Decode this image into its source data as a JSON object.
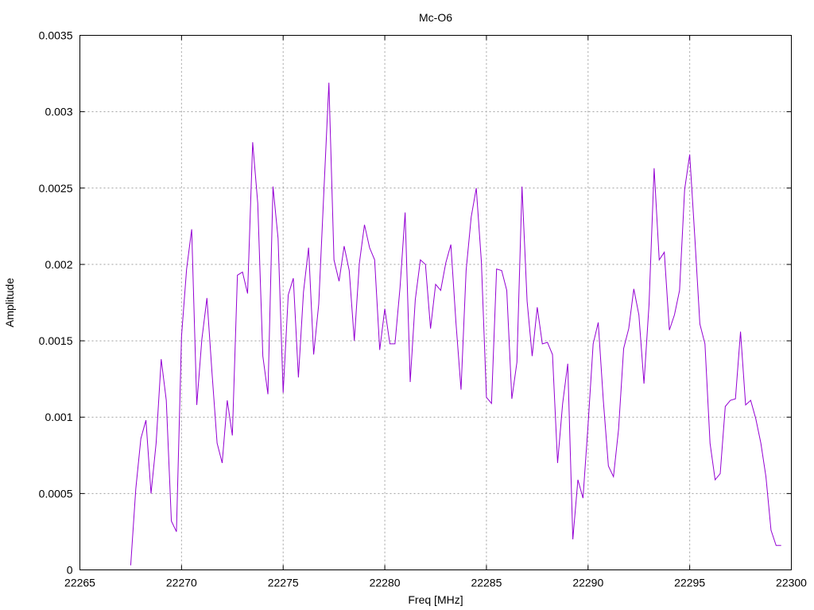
{
  "chart_data": {
    "type": "line",
    "title": "Mc-O6",
    "xlabel": "Freq [MHz]",
    "ylabel": "Amplitude",
    "xlim": [
      22265,
      22300
    ],
    "ylim": [
      0,
      0.0035
    ],
    "x_ticks": [
      "22265",
      "22270",
      "22275",
      "22280",
      "22285",
      "22290",
      "22295",
      "22300"
    ],
    "y_ticks": [
      "0",
      "0.0005",
      "0.001",
      "0.0015",
      "0.002",
      "0.0025",
      "0.003",
      "0.0035"
    ],
    "grid": true,
    "series": [
      {
        "color": "#9400d3",
        "points": [
          [
            22267.5,
            3e-05
          ],
          [
            22267.75,
            0.00053
          ],
          [
            22268.0,
            0.00086
          ],
          [
            22268.25,
            0.00098
          ],
          [
            22268.5,
            0.0005
          ],
          [
            22268.75,
            0.00083
          ],
          [
            22269.0,
            0.00138
          ],
          [
            22269.25,
            0.00111
          ],
          [
            22269.5,
            0.00032
          ],
          [
            22269.75,
            0.00025
          ],
          [
            22270.0,
            0.00153
          ],
          [
            22270.25,
            0.00197
          ],
          [
            22270.5,
            0.00223
          ],
          [
            22270.75,
            0.00108
          ],
          [
            22271.0,
            0.00151
          ],
          [
            22271.25,
            0.00178
          ],
          [
            22271.5,
            0.00129
          ],
          [
            22271.75,
            0.00083
          ],
          [
            22272.0,
            0.0007
          ],
          [
            22272.25,
            0.00111
          ],
          [
            22272.5,
            0.00088
          ],
          [
            22272.75,
            0.00193
          ],
          [
            22273.0,
            0.00195
          ],
          [
            22273.25,
            0.00181
          ],
          [
            22273.5,
            0.0028
          ],
          [
            22273.75,
            0.0024
          ],
          [
            22274.0,
            0.0014
          ],
          [
            22274.25,
            0.00115
          ],
          [
            22274.5,
            0.00251
          ],
          [
            22274.75,
            0.00217
          ],
          [
            22275.0,
            0.00116
          ],
          [
            22275.25,
            0.0018
          ],
          [
            22275.5,
            0.00191
          ],
          [
            22275.75,
            0.00126
          ],
          [
            22276.0,
            0.00182
          ],
          [
            22276.25,
            0.00211
          ],
          [
            22276.5,
            0.00141
          ],
          [
            22276.75,
            0.00174
          ],
          [
            22277.0,
            0.00247
          ],
          [
            22277.25,
            0.00319
          ],
          [
            22277.5,
            0.00203
          ],
          [
            22277.75,
            0.00189
          ],
          [
            22278.0,
            0.00212
          ],
          [
            22278.25,
            0.00196
          ],
          [
            22278.5,
            0.0015
          ],
          [
            22278.75,
            0.00201
          ],
          [
            22279.0,
            0.00226
          ],
          [
            22279.25,
            0.00211
          ],
          [
            22279.5,
            0.00203
          ],
          [
            22279.75,
            0.00144
          ],
          [
            22280.0,
            0.00171
          ],
          [
            22280.25,
            0.00148
          ],
          [
            22280.5,
            0.00148
          ],
          [
            22280.75,
            0.00185
          ],
          [
            22281.0,
            0.00234
          ],
          [
            22281.25,
            0.00123
          ],
          [
            22281.5,
            0.00177
          ],
          [
            22281.75,
            0.00203
          ],
          [
            22282.0,
            0.002
          ],
          [
            22282.25,
            0.00158
          ],
          [
            22282.5,
            0.00187
          ],
          [
            22282.75,
            0.00183
          ],
          [
            22283.0,
            0.00201
          ],
          [
            22283.25,
            0.00213
          ],
          [
            22283.5,
            0.00162
          ],
          [
            22283.75,
            0.00118
          ],
          [
            22284.0,
            0.00196
          ],
          [
            22284.25,
            0.00231
          ],
          [
            22284.5,
            0.0025
          ],
          [
            22284.75,
            0.00202
          ],
          [
            22285.0,
            0.00113
          ],
          [
            22285.25,
            0.00109
          ],
          [
            22285.5,
            0.00197
          ],
          [
            22285.75,
            0.00196
          ],
          [
            22286.0,
            0.00183
          ],
          [
            22286.25,
            0.00112
          ],
          [
            22286.5,
            0.00136
          ],
          [
            22286.75,
            0.00251
          ],
          [
            22287.0,
            0.00176
          ],
          [
            22287.25,
            0.0014
          ],
          [
            22287.5,
            0.00172
          ],
          [
            22287.75,
            0.00148
          ],
          [
            22288.0,
            0.00149
          ],
          [
            22288.25,
            0.00141
          ],
          [
            22288.5,
            0.0007
          ],
          [
            22288.75,
            0.00109
          ],
          [
            22289.0,
            0.00135
          ],
          [
            22289.25,
            0.0002
          ],
          [
            22289.5,
            0.00059
          ],
          [
            22289.75,
            0.00047
          ],
          [
            22290.0,
            0.00095
          ],
          [
            22290.25,
            0.00148
          ],
          [
            22290.5,
            0.00162
          ],
          [
            22290.75,
            0.00111
          ],
          [
            22291.0,
            0.00068
          ],
          [
            22291.25,
            0.00061
          ],
          [
            22291.5,
            0.00092
          ],
          [
            22291.75,
            0.00145
          ],
          [
            22292.0,
            0.00158
          ],
          [
            22292.25,
            0.00184
          ],
          [
            22292.5,
            0.00167
          ],
          [
            22292.75,
            0.00122
          ],
          [
            22293.0,
            0.00174
          ],
          [
            22293.25,
            0.00263
          ],
          [
            22293.5,
            0.00203
          ],
          [
            22293.75,
            0.00208
          ],
          [
            22294.0,
            0.00157
          ],
          [
            22294.25,
            0.00167
          ],
          [
            22294.5,
            0.00183
          ],
          [
            22294.75,
            0.00249
          ],
          [
            22295.0,
            0.00272
          ],
          [
            22295.25,
            0.00218
          ],
          [
            22295.5,
            0.00161
          ],
          [
            22295.75,
            0.00148
          ],
          [
            22296.0,
            0.00083
          ],
          [
            22296.25,
            0.00059
          ],
          [
            22296.5,
            0.00063
          ],
          [
            22296.75,
            0.00107
          ],
          [
            22297.0,
            0.00111
          ],
          [
            22297.25,
            0.00112
          ],
          [
            22297.5,
            0.00156
          ],
          [
            22297.75,
            0.00108
          ],
          [
            22298.0,
            0.00111
          ],
          [
            22298.25,
            0.00099
          ],
          [
            22298.5,
            0.00083
          ],
          [
            22298.75,
            0.00061
          ],
          [
            22299.0,
            0.00026
          ],
          [
            22299.25,
            0.00016
          ],
          [
            22299.5,
            0.00016
          ]
        ]
      }
    ]
  }
}
